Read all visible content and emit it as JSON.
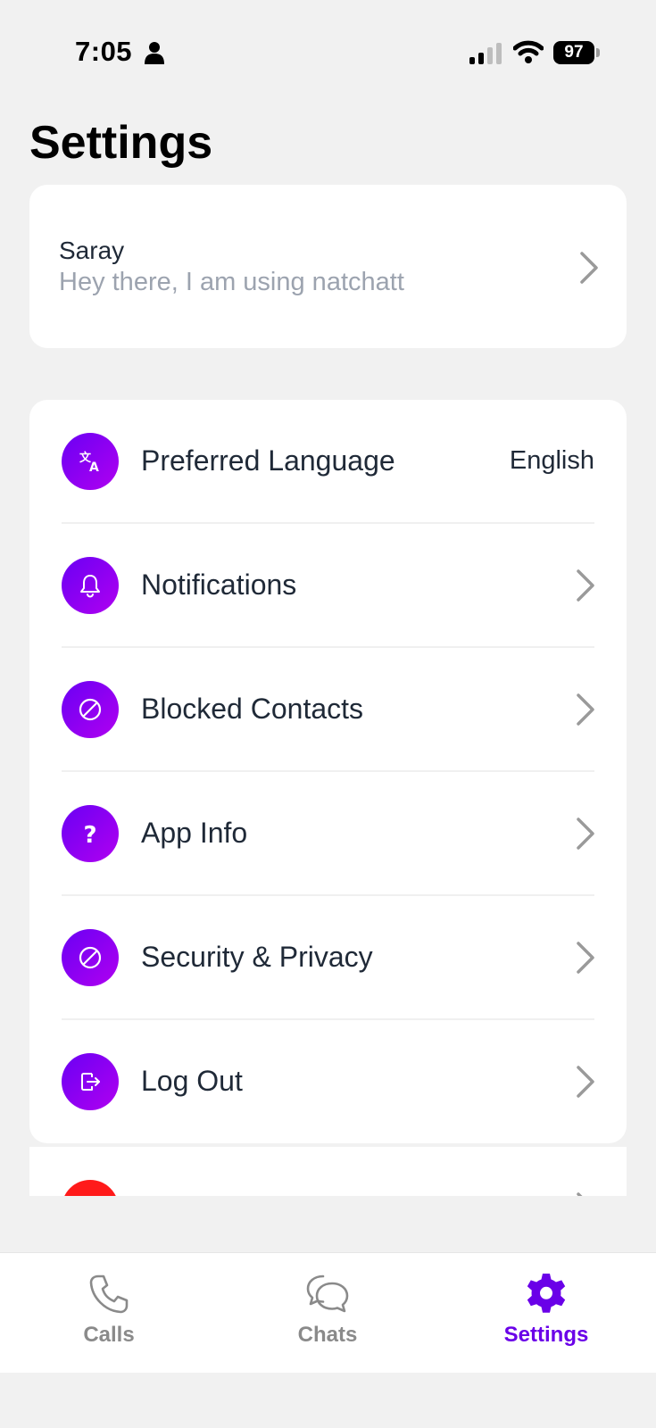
{
  "status_bar": {
    "time": "7:05",
    "battery": "97"
  },
  "page": {
    "title": "Settings"
  },
  "profile": {
    "name": "Saray",
    "status": "Hey there, I am using natchatt"
  },
  "settings_items": [
    {
      "label": "Preferred Language",
      "value": "English",
      "icon": "translate-icon"
    },
    {
      "label": "Notifications",
      "icon": "bell-icon"
    },
    {
      "label": "Blocked Contacts",
      "icon": "block-icon"
    },
    {
      "label": "App Info",
      "icon": "question-icon"
    },
    {
      "label": "Security & Privacy",
      "icon": "block-icon"
    },
    {
      "label": "Log Out",
      "icon": "logout-icon"
    }
  ],
  "tabs": [
    {
      "label": "Calls",
      "icon": "phone-icon",
      "active": false
    },
    {
      "label": "Chats",
      "icon": "chat-bubbles-icon",
      "active": false
    },
    {
      "label": "Settings",
      "icon": "gear-icon",
      "active": true
    }
  ],
  "colors": {
    "accent": "#6a00e8",
    "accent_gradient_end": "#b000f0",
    "danger": "#ff1a1a",
    "background": "#f1f1f1"
  }
}
